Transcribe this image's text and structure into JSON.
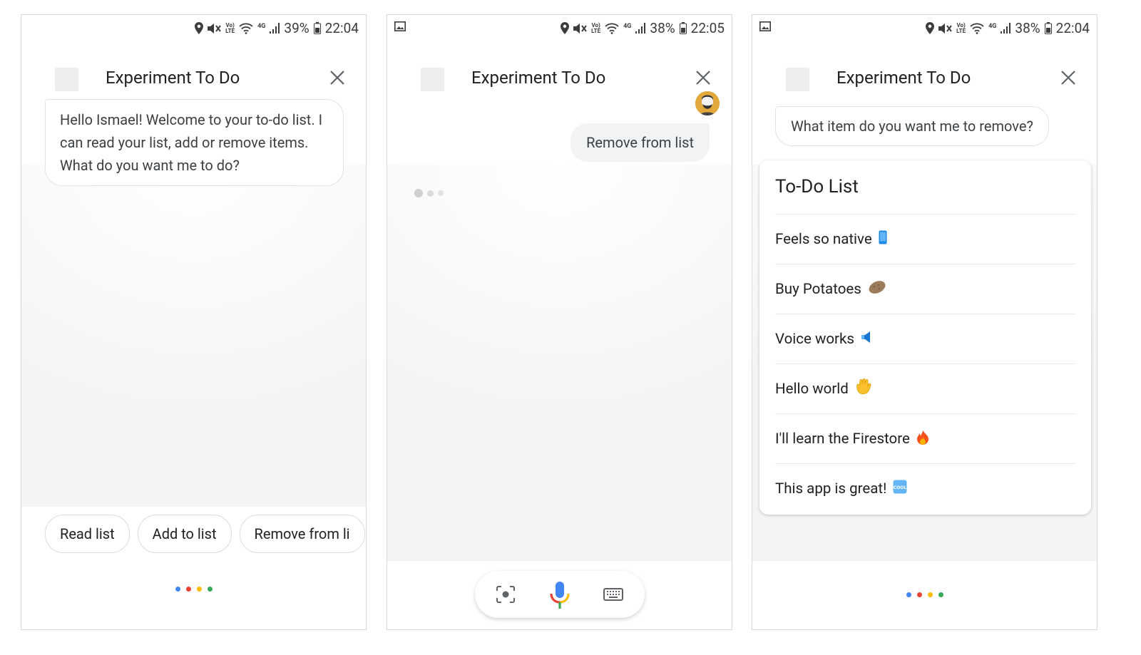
{
  "screens": [
    {
      "status": {
        "battery": "39%",
        "time": "22:04"
      },
      "header": {
        "title": "Experiment To Do"
      },
      "message": "Hello  Ismael! Welcome to your to-do list. I can read your list, add or remove items. What do you want me to do?",
      "chips": [
        "Read list",
        "Add to list",
        "Remove from li"
      ]
    },
    {
      "status": {
        "battery": "38%",
        "time": "22:05"
      },
      "header": {
        "title": "Experiment To Do"
      },
      "user_message": "Remove from list"
    },
    {
      "status": {
        "battery": "38%",
        "time": "22:04"
      },
      "header": {
        "title": "Experiment To Do"
      },
      "message": "What item do you want me to remove?",
      "card": {
        "title": "To-Do List",
        "items": [
          {
            "text": "Feels so native",
            "icon": "mobile-phone-emoji"
          },
          {
            "text": "Buy Potatoes",
            "icon": "potato-emoji"
          },
          {
            "text": "Voice works",
            "icon": "speaker-emoji"
          },
          {
            "text": "Hello world",
            "icon": "waving-hand-emoji"
          },
          {
            "text": "I'll learn the Firestore",
            "icon": "fire-emoji"
          },
          {
            "text": "This app is great!",
            "icon": "cool-button-emoji"
          }
        ]
      }
    }
  ],
  "colors": {
    "google_blue": "#4285f4",
    "google_red": "#ea4335",
    "google_yellow": "#fbbc05",
    "google_green": "#34a853"
  }
}
